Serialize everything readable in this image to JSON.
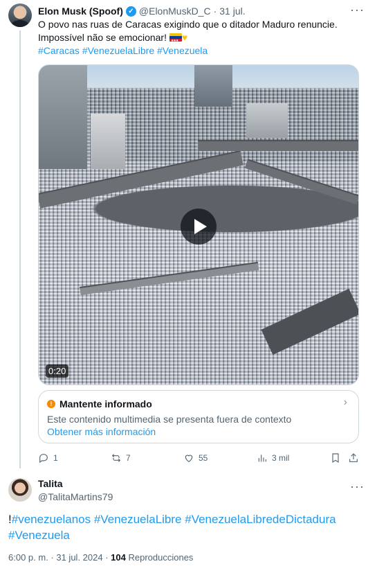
{
  "tweet1": {
    "author_name": "Elon Musk (Spoof)",
    "handle": "@ElonMuskD_C",
    "separator": "·",
    "date": "31 jul.",
    "text_line1": "O povo nas ruas de Caracas exigindo que o ditador Maduro renuncie.",
    "text_line2": "Impossível não se emocionar!",
    "hashtags": [
      "#Caracas",
      "#VenezuelaLibre",
      "#Venezuela"
    ],
    "video_duration": "0:20",
    "note": {
      "title": "Mantente informado",
      "description": "Este contenido multimedia se presenta fuera de contexto",
      "link": "Obtener más información"
    },
    "metrics": {
      "replies": "1",
      "reposts": "7",
      "likes": "55",
      "views": "3 mil"
    }
  },
  "tweet2": {
    "author_name": "Talita",
    "handle": "@TalitaMartins79",
    "text_prefix": "!",
    "hashtags": [
      "#venezuelanos",
      "#VenezuelaLibre",
      "#VenezuelaLibredeDictadura",
      "#Venezuela"
    ],
    "timestamp": "6:00 p. m. · 31 jul. 2024 ·",
    "views_count": "104",
    "views_label": "Reproducciones"
  },
  "icons": {
    "verified": "verified-badge-icon",
    "more": "more-icon",
    "play": "play-icon",
    "info": "info-icon",
    "chevron": "chevron-right-icon",
    "reply": "reply-icon",
    "repost": "repost-icon",
    "like": "like-icon",
    "views": "views-icon",
    "bookmark": "bookmark-icon",
    "share": "share-icon"
  },
  "colors": {
    "link": "#1d9bf0",
    "muted": "#536471",
    "note_icon": "#f58a07"
  }
}
